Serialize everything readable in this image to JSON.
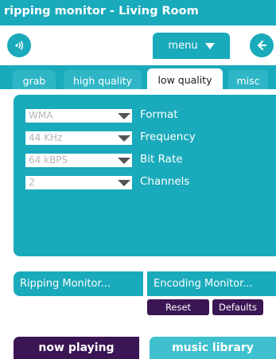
{
  "window": {
    "title": "ripping monitor - Living Room"
  },
  "header": {
    "menu_label": "menu"
  },
  "tabs": [
    {
      "label": "grab",
      "active": false
    },
    {
      "label": "high quality",
      "active": false
    },
    {
      "label": "low quality",
      "active": true
    },
    {
      "label": "misc",
      "active": false
    }
  ],
  "settings": [
    {
      "value": "WMA",
      "label": "Format"
    },
    {
      "value": "44 KHz",
      "label": "Frequency"
    },
    {
      "value": "64 kBPS",
      "label": "Bit Rate"
    },
    {
      "value": "2",
      "label": "Channels"
    }
  ],
  "monitors": {
    "ripping_label": "Ripping Monitor...",
    "encoding_label": "Encoding Monitor...",
    "reset_label": "Reset",
    "defaults_label": "Defaults"
  },
  "bottom_nav": {
    "now_playing_label": "now playing",
    "music_library_label": "music library"
  },
  "icons": {
    "speaker": "speaker-icon",
    "back": "back-arrow-icon",
    "menu_caret": "chevron-down-icon"
  },
  "colors": {
    "teal": "#19aabb",
    "dark_purple": "#3b1655",
    "light_teal": "#3fc0cf"
  }
}
